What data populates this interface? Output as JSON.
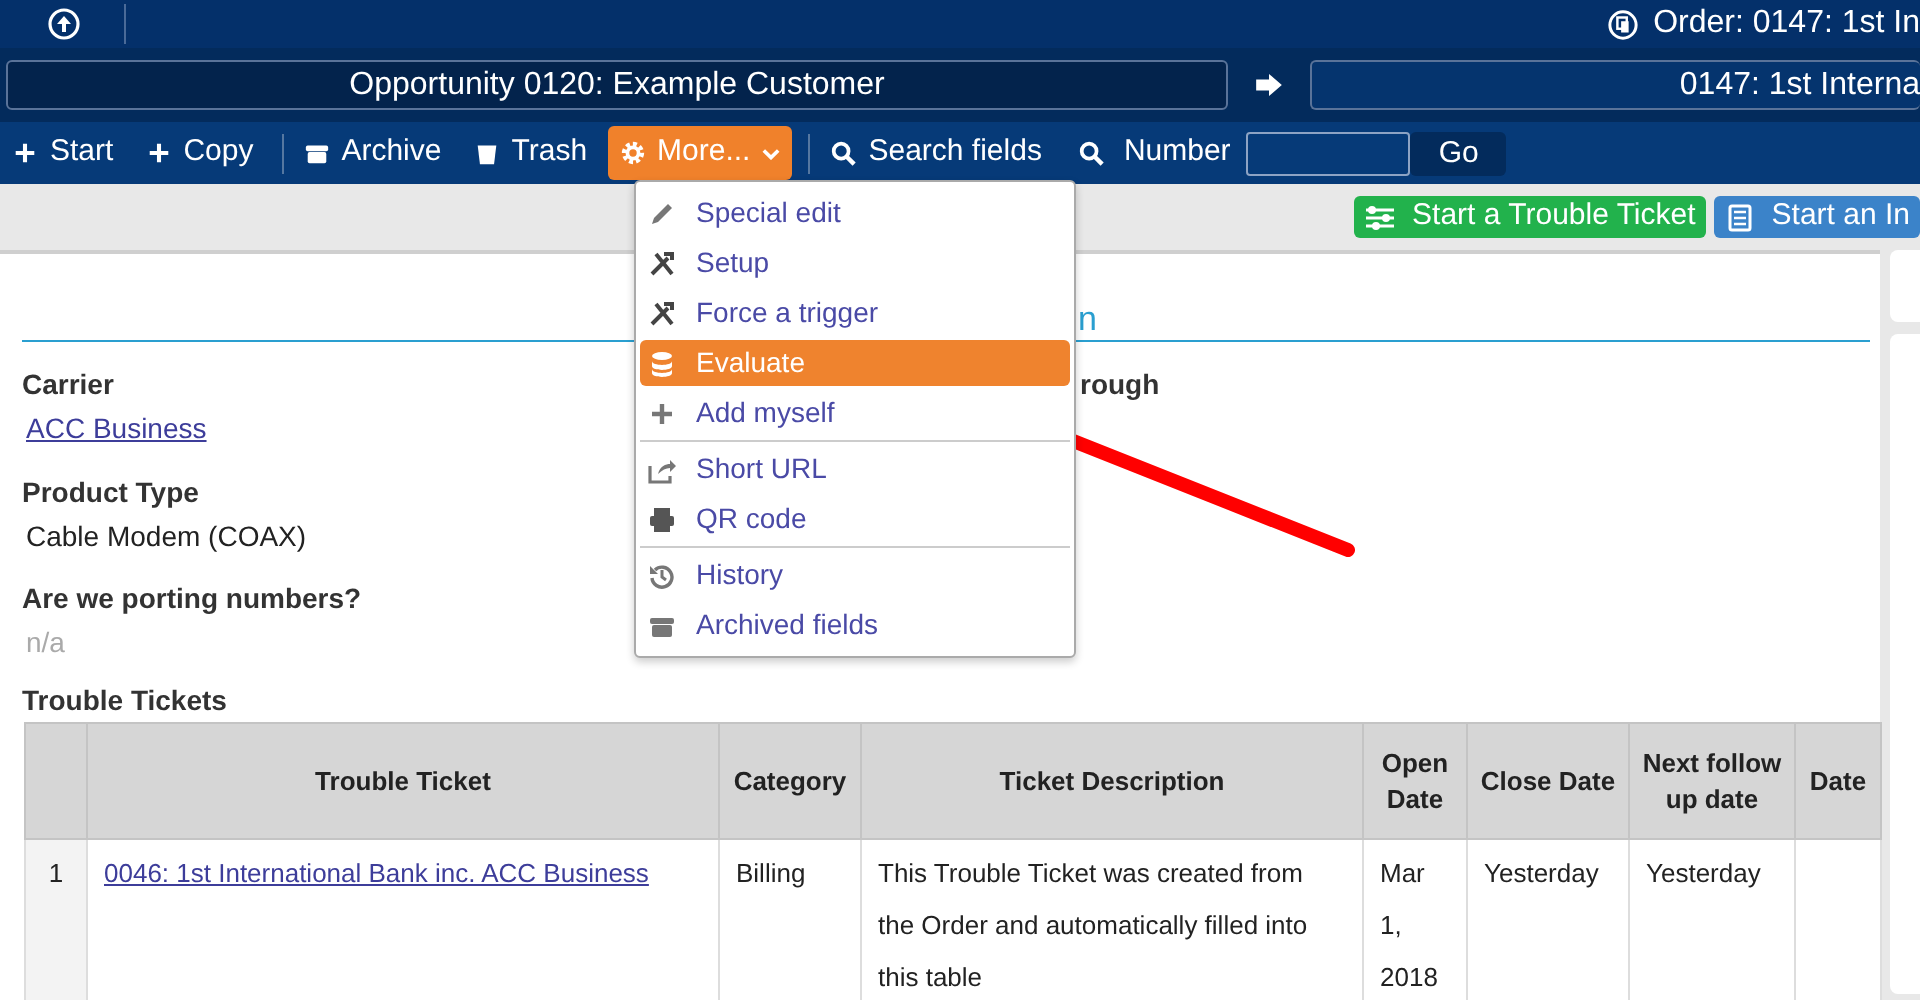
{
  "top_bar": {
    "order_title": "Order: 0147: 1st In"
  },
  "breadcrumb": {
    "source": "Opportunity 0120: Example Customer",
    "target": "0147: 1st Interna"
  },
  "toolbar": [
    {
      "kind": "button",
      "label": "Start"
    },
    {
      "kind": "button",
      "label": "Copy"
    },
    {
      "kind": "divider"
    },
    {
      "kind": "button",
      "label": "Archive"
    },
    {
      "kind": "button",
      "label": "Trash"
    },
    {
      "kind": "menu",
      "label": "More...",
      "expanded": true
    },
    {
      "kind": "divider"
    },
    {
      "kind": "button",
      "label": "Search fields"
    },
    {
      "kind": "number",
      "label": "Number",
      "go": "Go"
    }
  ],
  "more_menu": [
    {
      "kind": "item",
      "label": "Special edit",
      "selected": false
    },
    {
      "kind": "item",
      "label": "Setup",
      "selected": false
    },
    {
      "kind": "item",
      "label": "Force a trigger",
      "selected": false
    },
    {
      "kind": "item",
      "label": "Evaluate",
      "selected": true
    },
    {
      "kind": "item",
      "label": "Add myself",
      "selected": false
    },
    {
      "kind": "separator"
    },
    {
      "kind": "item",
      "label": "Short URL",
      "selected": false
    },
    {
      "kind": "item",
      "label": "QR code",
      "selected": false
    },
    {
      "kind": "separator"
    },
    {
      "kind": "item",
      "label": "History",
      "selected": false
    },
    {
      "kind": "item",
      "label": "Archived fields",
      "selected": false
    }
  ],
  "action_buttons": [
    {
      "label": "Start a Trouble Ticket",
      "color": "#22b24c"
    },
    {
      "label": "Start an In",
      "color": "#3b83c9"
    }
  ],
  "section": {
    "heading": "n",
    "right_label": "rough",
    "fields": [
      {
        "label": "Carrier",
        "value": "ACC Business",
        "kind": "link"
      },
      {
        "label": "Product Type",
        "value": "Cable Modem (COAX)",
        "kind": "text"
      },
      {
        "label": "Are we porting numbers?",
        "value": "n/a",
        "kind": "empty"
      }
    ]
  },
  "table": {
    "title": "Trouble Tickets",
    "columns": [
      "Trouble Ticket",
      "Category",
      "Ticket Description",
      "Open Date",
      "Close Date",
      "Next follow up date",
      "Date"
    ],
    "rows": [
      {
        "index": "1",
        "cells": [
          {
            "text": "0046: 1st International Bank inc. ACC Business",
            "kind": "link"
          },
          {
            "text": "Billing",
            "kind": "text"
          },
          {
            "text": "This Trouble Ticket was created from the Order and automatically filled into this table",
            "kind": "text"
          },
          {
            "text": "Mar 1, 2018",
            "kind": "text"
          },
          {
            "text": "Yesterday",
            "kind": "text"
          },
          {
            "text": "Yesterday",
            "kind": "text"
          }
        ]
      }
    ]
  }
}
